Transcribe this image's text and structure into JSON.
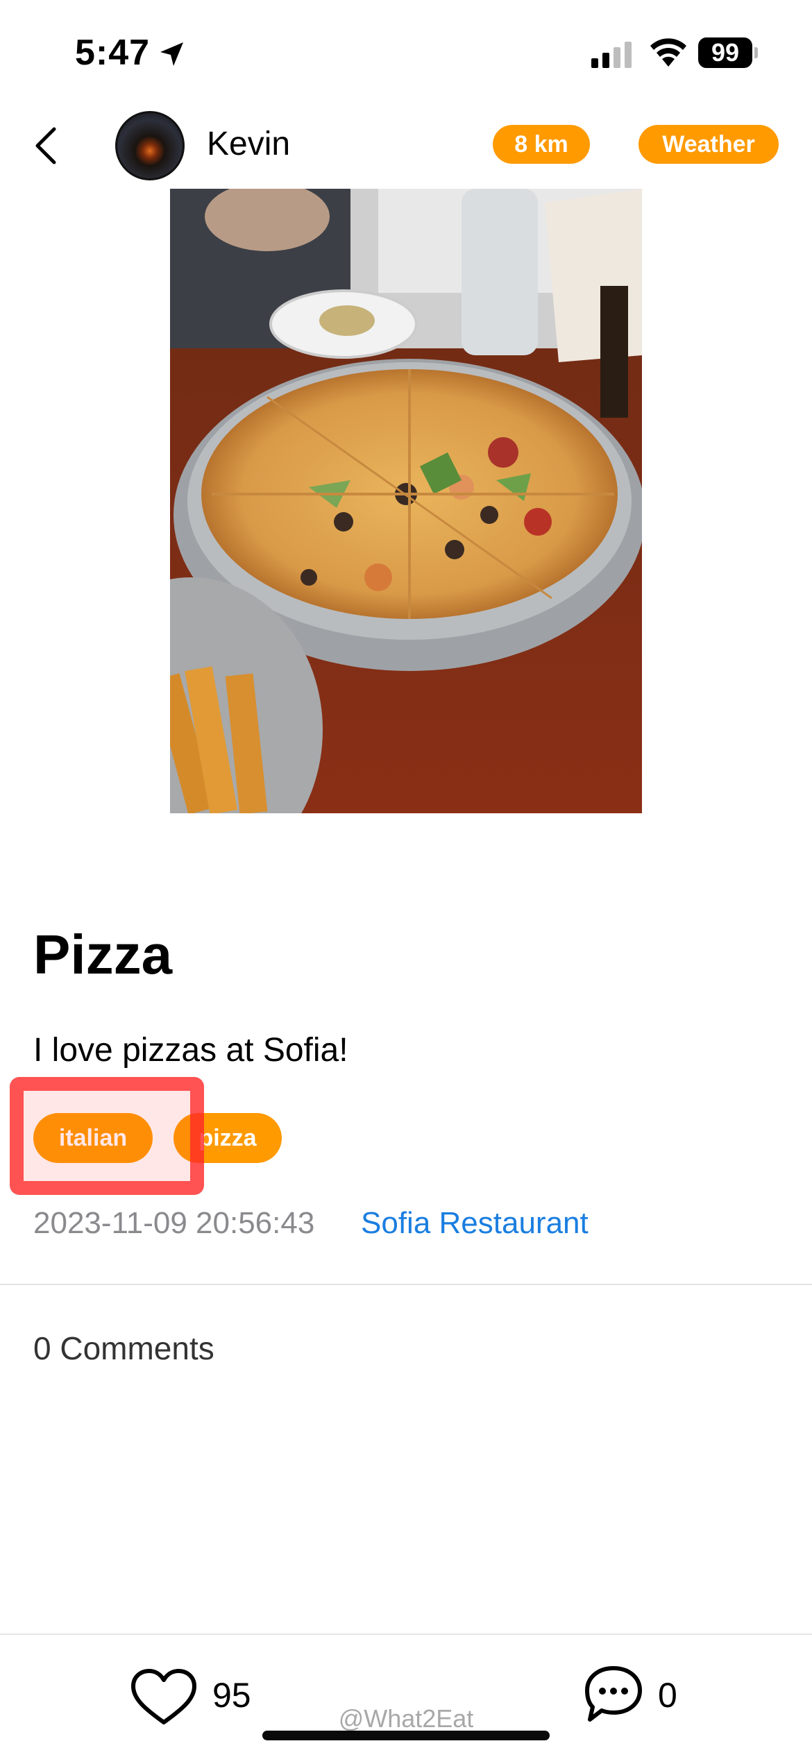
{
  "status_bar": {
    "time": "5:47",
    "battery": "99"
  },
  "header": {
    "user_name": "Kevin",
    "distance": "8 km",
    "weather": "Weather"
  },
  "post": {
    "title": "Pizza",
    "description": "I love pizzas at Sofia!",
    "tags": [
      "italian",
      "pizza"
    ],
    "timestamp": "2023-11-09 20:56:43",
    "restaurant": "Sofia Restaurant"
  },
  "comments": {
    "count_label": "0 Comments"
  },
  "footer": {
    "likes": "95",
    "comments": "0",
    "watermark": "@What2Eat"
  },
  "colors": {
    "accent": "#ff9a00",
    "link": "#1a7ee0",
    "highlight": "#ff2828"
  },
  "icons": {
    "back": "chevron-left-icon",
    "like": "heart-outline-icon",
    "comment": "speech-bubble-icon",
    "location": "location-arrow-icon",
    "signal": "cellular-signal-icon",
    "wifi": "wifi-icon"
  }
}
